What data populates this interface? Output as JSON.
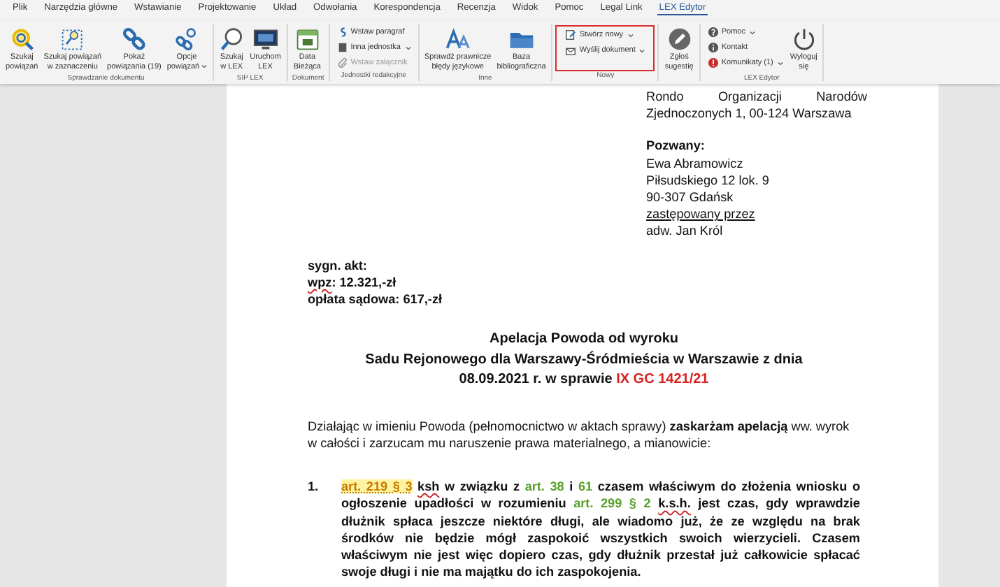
{
  "menu_tabs": [
    {
      "label": "Plik",
      "selected": false
    },
    {
      "label": "Narzędzia główne",
      "selected": false
    },
    {
      "label": "Wstawianie",
      "selected": false
    },
    {
      "label": "Projektowanie",
      "selected": false
    },
    {
      "label": "Układ",
      "selected": false
    },
    {
      "label": "Odwołania",
      "selected": false
    },
    {
      "label": "Korespondencja",
      "selected": false
    },
    {
      "label": "Recenzja",
      "selected": false
    },
    {
      "label": "Widok",
      "selected": false
    },
    {
      "label": "Pomoc",
      "selected": false
    },
    {
      "label": "Legal Link",
      "selected": false
    },
    {
      "label": "LEX Edytor",
      "selected": true
    }
  ],
  "ribbon": {
    "groups": [
      {
        "label": "Sprawdzanie dokumentu",
        "highlighted": false,
        "items": [
          {
            "kind": "large",
            "label": "Szukaj\npowiązań",
            "dropdown": false,
            "disabled": false
          },
          {
            "kind": "large",
            "label": "Szukaj powiązań\nw zaznaczeniu",
            "dropdown": false,
            "disabled": false
          },
          {
            "kind": "large",
            "label": "Pokaż\npowiązania (19)",
            "dropdown": false,
            "disabled": false
          },
          {
            "kind": "large",
            "label": "Opcje\npowiązań",
            "dropdown": true,
            "disabled": false
          }
        ]
      },
      {
        "label": "SIP LEX",
        "highlighted": false,
        "items": [
          {
            "kind": "large",
            "label": "Szukaj\nw LEX",
            "dropdown": false,
            "disabled": false
          },
          {
            "kind": "large",
            "label": "Uruchom\nLEX",
            "dropdown": false,
            "disabled": false
          }
        ]
      },
      {
        "label": "Dokument",
        "highlighted": false,
        "items": [
          {
            "kind": "large",
            "label": "Data\nBieżąca",
            "dropdown": false,
            "disabled": false
          }
        ]
      },
      {
        "label": "Jednostki redakcyjne",
        "highlighted": false,
        "items": [
          {
            "kind": "small",
            "label": "Wstaw paragraf",
            "dropdown": false,
            "disabled": false
          },
          {
            "kind": "small",
            "label": "Inna jednostka",
            "dropdown": true,
            "disabled": false
          },
          {
            "kind": "small",
            "label": "Wstaw załącznik",
            "dropdown": false,
            "disabled": true
          }
        ]
      },
      {
        "label": "Inne",
        "highlighted": false,
        "items": [
          {
            "kind": "large",
            "label": "Sprawdź prawnicze\nbłędy językowe",
            "dropdown": false,
            "disabled": false
          },
          {
            "kind": "large",
            "label": "Baza\nbibliograficzna",
            "dropdown": false,
            "disabled": false
          }
        ]
      },
      {
        "label": "Nowy",
        "highlighted": true,
        "items": [
          {
            "kind": "small",
            "label": "Stwórz nowy",
            "dropdown": true,
            "disabled": false
          },
          {
            "kind": "small",
            "label": "Wyślij dokument",
            "dropdown": true,
            "disabled": false
          }
        ]
      },
      {
        "highlighted": false,
        "items": [
          {
            "kind": "large",
            "label": "Zgłoś\nsugestię",
            "dropdown": false,
            "disabled": false
          }
        ]
      },
      {
        "label": "LEX Edytor",
        "highlighted": false,
        "items": [
          {
            "kind": "small",
            "label": "Pomoc",
            "dropdown": true,
            "disabled": false
          },
          {
            "kind": "small",
            "label": "Kontakt",
            "dropdown": false,
            "disabled": false
          },
          {
            "kind": "small",
            "label": "Komunikaty (1)",
            "dropdown": true,
            "disabled": false
          },
          {
            "kind": "large",
            "label": "Wyloguj\nsię",
            "dropdown": false,
            "disabled": false
          }
        ]
      }
    ]
  },
  "document": {
    "recipient_address": [
      {
        "text": "Rondo Organizacji Narodów",
        "kind": "justified"
      },
      {
        "text": "Zjednoczonych 1, 00-124 Warszawa",
        "kind": "plain"
      }
    ],
    "defendant": {
      "heading": "Pozwany:",
      "lines": [
        {
          "text": "Ewa Abramowicz",
          "kind": "plain"
        },
        {
          "text": "Piłsudskiego 12 lok. 9",
          "kind": "plain"
        },
        {
          "text": "90-307  Gdańsk",
          "kind": "plain"
        },
        {
          "text": "zastępowany przez",
          "kind": "underlined"
        },
        {
          "text": "adw. Jan Król",
          "kind": "plain"
        }
      ]
    },
    "case_info": [
      [
        {
          "kind": "text",
          "text": "sygn. akt:"
        }
      ],
      [
        {
          "kind": "spelling",
          "text": "wpz"
        },
        {
          "kind": "text",
          "text": ": 12.321,-zł"
        }
      ],
      [
        {
          "kind": "text",
          "text": "opłata sądowa: 617,-zł"
        }
      ]
    ],
    "title": [
      [
        {
          "kind": "text",
          "text": "Apelacja Powoda od wyroku"
        }
      ],
      [
        {
          "kind": "text",
          "text": "Sadu Rejonowego dla Warszawy-Śródmieścia w Warszawie z dnia"
        }
      ],
      [
        {
          "kind": "text",
          "text": "08.09.2021 r.  w sprawie "
        },
        {
          "kind": "case-number",
          "text": "IX GC 1421/21"
        }
      ]
    ],
    "intro": [
      {
        "kind": "text",
        "text": "Działając w imieniu Powoda (pełnomocnictwo w aktach sprawy) "
      },
      {
        "kind": "strong",
        "text": "zaskarżam apelacją"
      },
      {
        "kind": "text",
        "text": " ww. wyrok w całości i zarzucam mu naruszenie prawa materialnego, a mianowicie:"
      }
    ],
    "points": [
      {
        "number": "1.",
        "segments": [
          {
            "kind": "highlighted-reference",
            "text": "art. 219 § 3"
          },
          {
            "kind": "spelling",
            "text": " ksh"
          },
          {
            "kind": "text",
            "text": " w związku z "
          },
          {
            "kind": "reference",
            "text": "art. 38"
          },
          {
            "kind": "text",
            "text": " i "
          },
          {
            "kind": "reference",
            "text": "61"
          },
          {
            "kind": "text",
            "text": " czasem właściwym do złożenia wniosku o ogłoszenie upadłości w rozumieniu "
          },
          {
            "kind": "reference",
            "text": "art. 299 § 2"
          },
          {
            "kind": "spelling",
            "text": " k.s.h."
          },
          {
            "kind": "text",
            "text": " jest czas, gdy wprawdzie dłużnik spłaca jeszcze niektóre długi, ale wiadomo już, że ze względu na brak środków nie będzie mógł zaspokoić wszystkich swoich wierzycieli. Czasem właściwym nie jest więc dopiero czas, gdy dłużnik przestał już całkowicie spłacać swoje długi i nie ma majątku do ich zaspokojenia."
          }
        ]
      }
    ]
  }
}
